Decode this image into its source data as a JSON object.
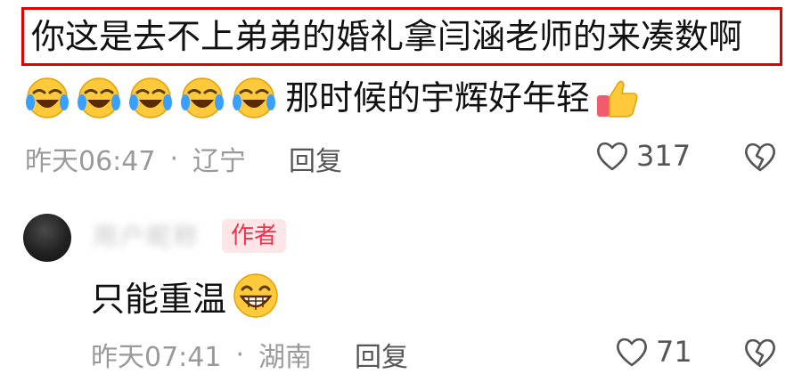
{
  "comment": {
    "text": "你这是去不上弟弟的婚礼拿闫涵老师的来凑数啊",
    "emoji_line_text": "那时候的宇辉好年轻",
    "emojis": [
      "laughing-crying-emoji",
      "laughing-crying-emoji",
      "laughing-crying-emoji",
      "laughing-crying-emoji",
      "laughing-crying-emoji",
      "thumbs-up-emoji"
    ],
    "time": "昨天06:47",
    "separator": "·",
    "location": "辽宁",
    "reply_label": "回复",
    "like_count": "317"
  },
  "reply": {
    "username": "用户昵称",
    "author_badge": "作者",
    "text": "只能重温",
    "emoji": "grinning-emoji",
    "time": "昨天07:41",
    "separator": "·",
    "location": "湖南",
    "reply_label": "回复",
    "like_count": "71"
  },
  "colors": {
    "highlight_border": "#e00000",
    "meta_gray": "#9a9a9a",
    "badge_bg": "#fde5e8",
    "badge_text": "#f2324b"
  }
}
